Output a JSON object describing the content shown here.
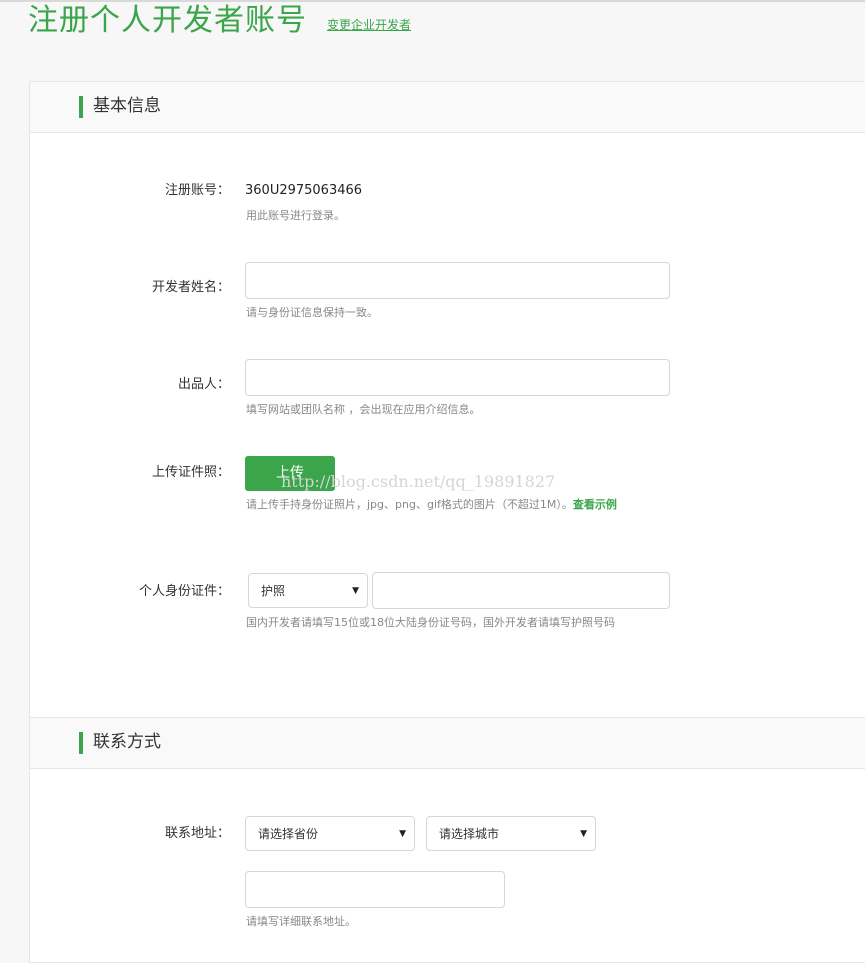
{
  "header": {
    "title": "注册个人开发者账号",
    "switch_link": "变更企业开发者"
  },
  "section_basic": {
    "title": "基本信息",
    "account": {
      "label": "注册账号：",
      "value": "360U2975063466",
      "hint": "用此账号进行登录。"
    },
    "name": {
      "label": "开发者姓名：",
      "value": "",
      "hint": "请与身份证信息保持一致。"
    },
    "producer": {
      "label": "出品人：",
      "value": "",
      "hint": "填写网站或团队名称 ，会出现在应用介绍信息。"
    },
    "upload": {
      "label": "上传证件照：",
      "button": "上传",
      "hint": "请上传手持身份证照片，jpg、png、gif格式的图片（不超过1M）。",
      "demo_link": "查看示例",
      "watermark": "http://blog.csdn.net/qq_19891827"
    },
    "id_doc": {
      "label": "个人身份证件：",
      "type_selected": "护照",
      "number_value": "",
      "hint": "国内开发者请填写15位或18位大陆身份证号码，国外开发者请填写护照号码"
    }
  },
  "section_contact": {
    "title": "联系方式",
    "address": {
      "label": "联系地址：",
      "province_selected": "请选择省份",
      "city_selected": "请选择城市",
      "detail_value": "",
      "hint": "请填写详细联系地址。"
    }
  },
  "colors": {
    "accent": "#3aa54a",
    "hint_text": "#888888",
    "border": "#d6d6d6"
  }
}
